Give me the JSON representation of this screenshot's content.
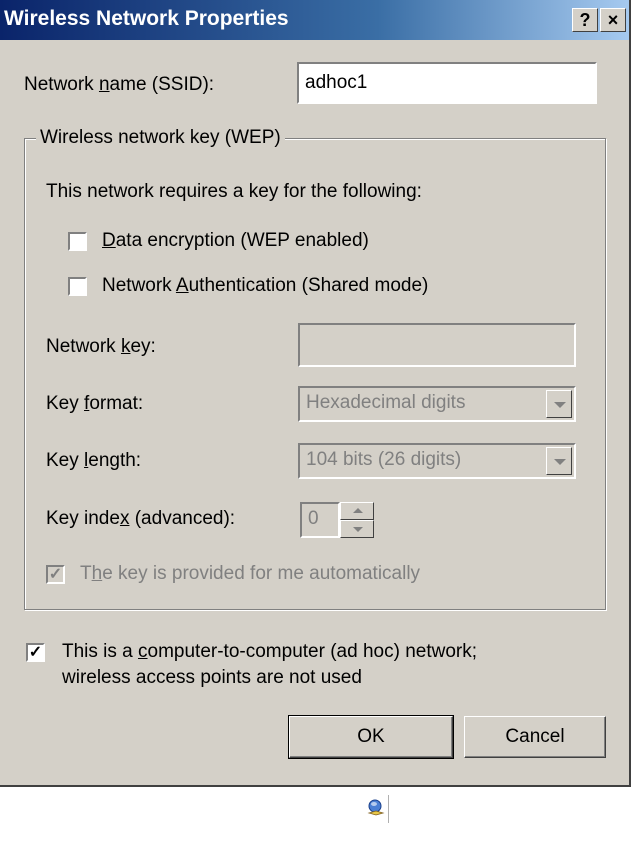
{
  "titlebar": {
    "title": "Wireless Network Properties",
    "help_label": "?",
    "close_label": "×"
  },
  "ssid": {
    "label_prefix": "Network ",
    "label_accel": "n",
    "label_suffix": "ame (SSID):",
    "value": "adhoc1"
  },
  "wep_group": {
    "legend": "Wireless network key (WEP)",
    "requires_text": "This network requires a key for the following:",
    "data_encryption": {
      "accel": "D",
      "rest": "ata encryption (WEP enabled)",
      "checked": false
    },
    "network_auth": {
      "prefix": "Network ",
      "accel": "A",
      "rest": "uthentication (Shared mode)",
      "checked": false
    },
    "network_key": {
      "prefix": "Network ",
      "accel": "k",
      "rest": "ey:",
      "value": ""
    },
    "key_format": {
      "prefix": "Key ",
      "accel": "f",
      "rest": "ormat:",
      "selected": "Hexadecimal digits"
    },
    "key_length": {
      "prefix": "Key ",
      "accel": "l",
      "rest": "ength:",
      "selected": "104 bits (26 digits)"
    },
    "key_index": {
      "prefix": "Key inde",
      "accel": "x",
      "rest": " (advanced):",
      "value": "0"
    },
    "auto_key": {
      "prefix": "T",
      "accel": "h",
      "rest": "e key is provided for me automatically",
      "checked": true,
      "enabled": false
    }
  },
  "adhoc": {
    "line1_prefix": "This is a ",
    "line1_accel": "c",
    "line1_rest": "omputer-to-computer (ad hoc) network;",
    "line2": "wireless access points are not used",
    "checked": true
  },
  "buttons": {
    "ok": "OK",
    "cancel": "Cancel"
  },
  "colors": {
    "dialog_bg": "#d4d0c8",
    "title_start": "#0a246a",
    "title_end": "#a6caf0",
    "disabled_text": "#808080"
  },
  "icons": {
    "tray": "network-tray-icon"
  }
}
